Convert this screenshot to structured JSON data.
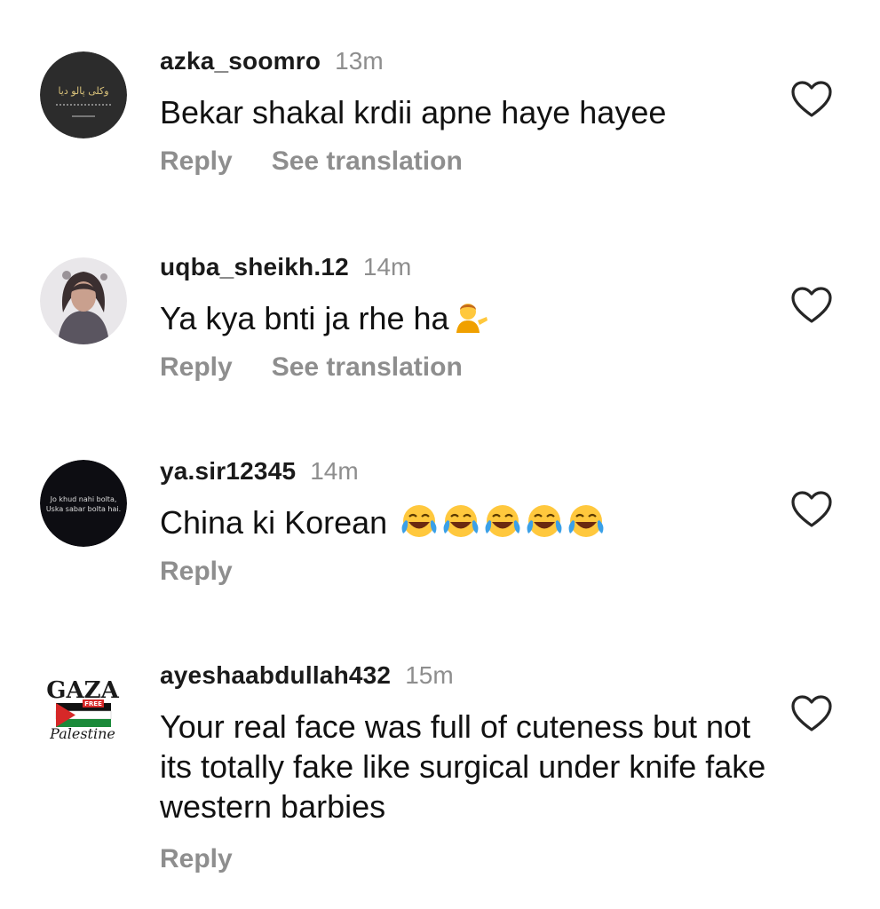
{
  "comments": [
    {
      "username": "azka_soomro",
      "time": "13m",
      "text": "Bekar shakal krdii apne haye hayee",
      "reply_label": "Reply",
      "translate_label": "See translation",
      "avatar": "dark-calligraphy-avatar",
      "avatar_text": "وکلی پالو دیا"
    },
    {
      "username": "uqba_sheikh.12",
      "time": "14m",
      "text": "Ya kya bnti ja rhe ha",
      "emoji": "person-tipping-hand-emoji",
      "reply_label": "Reply",
      "translate_label": "See translation",
      "avatar": "profile-photo-avatar"
    },
    {
      "username": "ya.sir12345",
      "time": "14m",
      "text": "China ki Korean",
      "emoji": "face-with-tears-of-joy-emoji x5",
      "reply_label": "Reply",
      "avatar": "dark-text-avatar",
      "avatar_text_1": "Jo khud nahi bolta,",
      "avatar_text_2": "Uska sabar bolta hai."
    },
    {
      "username": "ayeshaabdullah432",
      "time": "15m",
      "text": "Your real face was full of cuteness but not its totally fake like surgical under knife fake western barbies",
      "reply_label": "Reply",
      "avatar": "gaza-palestine-avatar",
      "avatar_text_1": "GAZA",
      "avatar_text_2": "FREE",
      "avatar_text_3": "Palestine"
    }
  ],
  "colors": {
    "secondary_text": "#8e8e8e",
    "primary_text": "#111111",
    "background": "#ffffff"
  },
  "icons": {
    "like": "heart-outline-icon"
  }
}
